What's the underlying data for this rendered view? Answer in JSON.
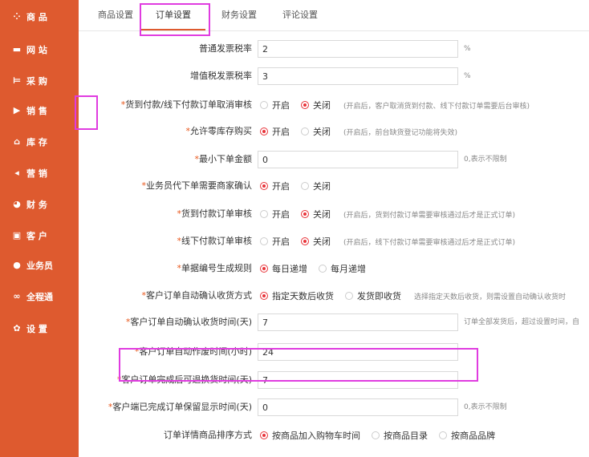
{
  "sidebar": {
    "items": [
      {
        "icon": "grid-icon",
        "glyph": "⁘",
        "label": "商 品"
      },
      {
        "icon": "monitor-icon",
        "glyph": "▬",
        "label": "网 站"
      },
      {
        "icon": "cart-icon",
        "glyph": "⊨",
        "label": "采 购"
      },
      {
        "icon": "sales-icon",
        "glyph": "▶",
        "label": "销 售"
      },
      {
        "icon": "warehouse-icon",
        "glyph": "⌂",
        "label": "库 存"
      },
      {
        "icon": "megaphone-icon",
        "glyph": "◂",
        "label": "营 销"
      },
      {
        "icon": "pie-chart-icon",
        "glyph": "◕",
        "label": "财 务"
      },
      {
        "icon": "briefcase-icon",
        "glyph": "▣",
        "label": "客 户"
      },
      {
        "icon": "user-icon",
        "glyph": "●",
        "label": "业务员"
      },
      {
        "icon": "link-icon",
        "glyph": "∞",
        "label": "全程通"
      },
      {
        "icon": "gear-icon",
        "glyph": "✿",
        "label": "设 置"
      }
    ]
  },
  "tabs": [
    {
      "label": "商品设置"
    },
    {
      "label": "订单设置",
      "active": true
    },
    {
      "label": "财务设置"
    },
    {
      "label": "评论设置"
    }
  ],
  "form": {
    "rows": [
      {
        "label": "普通发票税率",
        "required": false,
        "type": "input",
        "value": "2",
        "unit": "%"
      },
      {
        "label": "增值税发票税率",
        "required": false,
        "type": "input",
        "value": "3",
        "unit": "%"
      },
      {
        "label": "货到付款/线下付款订单取消审核",
        "required": true,
        "type": "radio",
        "options": [
          "开启",
          "关闭"
        ],
        "selected": 1,
        "hint": "(开启后，客户取消货到付款、线下付款订单需要后台审核)"
      },
      {
        "label": "允许零库存购买",
        "required": true,
        "type": "radio",
        "options": [
          "开启",
          "关闭"
        ],
        "selected": 0,
        "hint": "(开启后，前台缺货登记功能将失效)"
      },
      {
        "label": "最小下单金额",
        "required": true,
        "type": "input",
        "value": "0",
        "unit": "0,表示不限制"
      },
      {
        "label": "业务员代下单需要商家确认",
        "required": true,
        "type": "radio",
        "options": [
          "开启",
          "关闭"
        ],
        "selected": 0,
        "hint": ""
      },
      {
        "label": "货到付款订单审核",
        "required": true,
        "type": "radio",
        "options": [
          "开启",
          "关闭"
        ],
        "selected": 1,
        "hint": "(开启后，货到付款订单需要审核通过后才是正式订单)"
      },
      {
        "label": "线下付款订单审核",
        "required": true,
        "type": "radio",
        "options": [
          "开启",
          "关闭"
        ],
        "selected": 1,
        "hint": "(开启后，线下付款订单需要审核通过后才是正式订单)"
      },
      {
        "label": "单据编号生成规则",
        "required": true,
        "type": "radio",
        "options": [
          "每日递增",
          "每月递增"
        ],
        "selected": 0,
        "hint": ""
      },
      {
        "label": "客户订单自动确认收货方式",
        "required": true,
        "type": "radio",
        "options": [
          "指定天数后收货",
          "发货即收货"
        ],
        "selected": 0,
        "hint": "选择指定天数后收货，则需设置自动确认收货时"
      },
      {
        "label": "客户订单自动确认收货时间(天)",
        "required": true,
        "type": "input",
        "value": "7",
        "unit": "订单全部发货后，超过设置时间，自"
      },
      {
        "label": "客户订单自动作废时间(小时)",
        "required": true,
        "type": "input",
        "value": "24",
        "unit": ""
      },
      {
        "label": "客户订单完成后可退换货时间(天)",
        "required": true,
        "type": "input",
        "value": "7",
        "unit": ""
      },
      {
        "label": "客户端已完成订单保留显示时间(天)",
        "required": true,
        "type": "input",
        "value": "0",
        "unit": "0,表示不限制"
      },
      {
        "label": "订单详情商品排序方式",
        "required": false,
        "type": "radio",
        "options": [
          "按商品加入购物车时间",
          "按商品目录",
          "按商品品牌"
        ],
        "selected": 0,
        "hint": ""
      }
    ]
  }
}
